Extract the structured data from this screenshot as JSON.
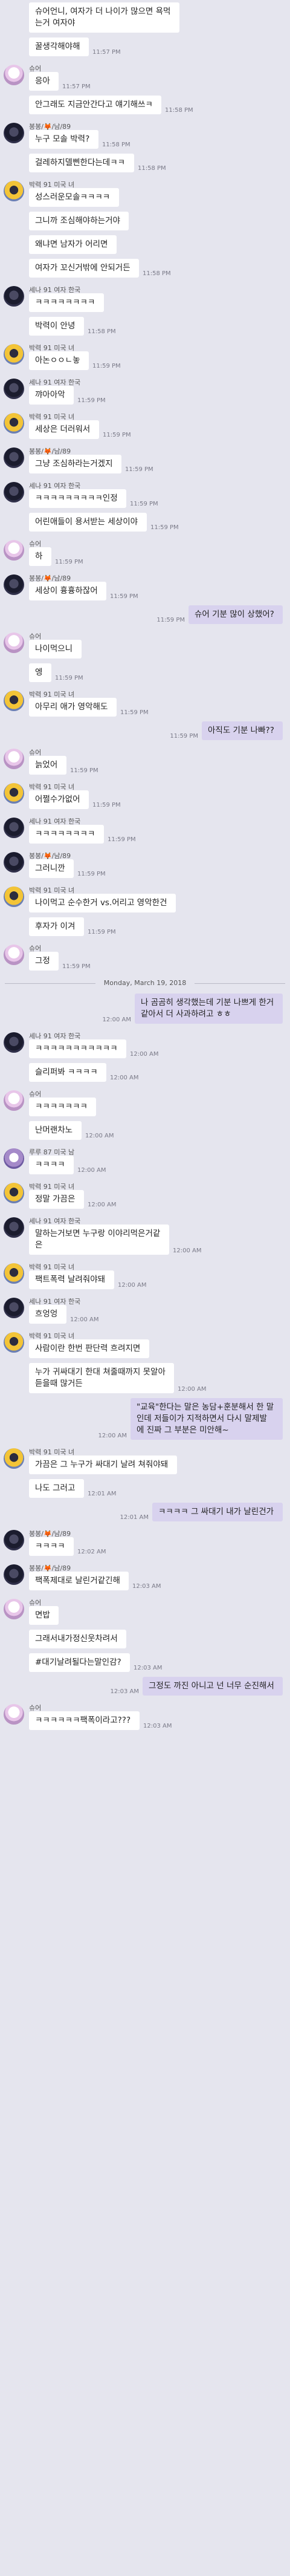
{
  "date_separator": "Monday, March 19, 2018",
  "messages": [
    {
      "side": "left",
      "sender": "",
      "avatar": "",
      "lines": [
        "슈어언니, 여자가 더 나이가 많으면 욕먹",
        "는거 여자야"
      ],
      "time": ""
    },
    {
      "side": "left",
      "sender": "",
      "avatar": "",
      "lines": [
        "꿀생각해야해"
      ],
      "time": "11:57 PM"
    },
    {
      "side": "left",
      "sender": "슈어",
      "avatar": "pink",
      "lines": [
        "응아"
      ],
      "time": "11:57 PM"
    },
    {
      "side": "left",
      "sender": "",
      "avatar": "",
      "lines": [
        "안그래도 지금안간다고 얘기해쓰ㅋ"
      ],
      "time": "11:58 PM"
    },
    {
      "side": "left",
      "sender": "봉봉/🦊/남/89",
      "avatar": "dark",
      "lines": [
        "누구 모솔 박력?"
      ],
      "time": "11:58 PM"
    },
    {
      "side": "left",
      "sender": "",
      "avatar": "",
      "lines": [
        "걸레하지델삔한다는데ㅋㅋ"
      ],
      "time": "11:58 PM"
    },
    {
      "side": "left",
      "sender": "박력 91 미국 녀",
      "avatar": "yellow",
      "lines": [
        "성스러운모솔ㅋㅋㅋㅋ"
      ],
      "time": ""
    },
    {
      "side": "left",
      "sender": "",
      "avatar": "",
      "lines": [
        "그니까 조심해야하는거야"
      ],
      "time": ""
    },
    {
      "side": "left",
      "sender": "",
      "avatar": "",
      "lines": [
        "왜냐면 남자가 어리면"
      ],
      "time": ""
    },
    {
      "side": "left",
      "sender": "",
      "avatar": "",
      "lines": [
        "여자가 꼬신거밖에 안되거든"
      ],
      "time": "11:58 PM"
    },
    {
      "side": "left",
      "sender": "세나 91 여자 한국",
      "avatar": "dark",
      "lines": [
        "ㅋㅋㅋㅋㅋㅋㅋㅋ"
      ],
      "time": ""
    },
    {
      "side": "left",
      "sender": "",
      "avatar": "",
      "lines": [
        "박력이 안녕"
      ],
      "time": "11:58 PM"
    },
    {
      "side": "left",
      "sender": "박력 91 미국 녀",
      "avatar": "yellow",
      "lines": [
        "아논ㅇㅇㄴ놓"
      ],
      "time": "11:59 PM"
    },
    {
      "side": "left",
      "sender": "세나 91 여자 한국",
      "avatar": "dark",
      "lines": [
        "꺄아아악"
      ],
      "time": "11:59 PM"
    },
    {
      "side": "left",
      "sender": "박력 91 미국 녀",
      "avatar": "yellow",
      "lines": [
        "세상은 더러워서"
      ],
      "time": "11:59 PM"
    },
    {
      "side": "left",
      "sender": "봉봉/🦊/남/89",
      "avatar": "dark",
      "lines": [
        "그냥 조심하라는거겠지"
      ],
      "time": "11:59 PM"
    },
    {
      "side": "left",
      "sender": "세나 91 여자 한국",
      "avatar": "dark",
      "lines": [
        "ㅋㅋㅋㅋㅋㅋㅋㅋㅋ인정"
      ],
      "time": "11:59 PM"
    },
    {
      "side": "left",
      "sender": "",
      "avatar": "",
      "lines": [
        "어린애들이 용서받는 세상이야"
      ],
      "time": "11:59 PM"
    },
    {
      "side": "left",
      "sender": "슈어",
      "avatar": "pink",
      "lines": [
        "하"
      ],
      "time": "11:59 PM"
    },
    {
      "side": "left",
      "sender": "봉봉/🦊/남/89",
      "avatar": "dark",
      "lines": [
        "세상이 흉흉하잖어"
      ],
      "time": "11:59 PM"
    },
    {
      "side": "right",
      "sender": "",
      "avatar": "",
      "lines": [
        "슈어 기분 많이 상했어?"
      ],
      "time": "11:59 PM"
    },
    {
      "side": "left",
      "sender": "슈어",
      "avatar": "pink",
      "lines": [
        "나이먹으니"
      ],
      "time": ""
    },
    {
      "side": "left",
      "sender": "",
      "avatar": "",
      "lines": [
        "엥"
      ],
      "time": "11:59 PM"
    },
    {
      "side": "left",
      "sender": "박력 91 미국 녀",
      "avatar": "yellow",
      "lines": [
        "아무리 애가 영악해도"
      ],
      "time": "11:59 PM"
    },
    {
      "side": "right",
      "sender": "",
      "avatar": "",
      "lines": [
        "아직도 기분 나빠??"
      ],
      "time": "11:59 PM"
    },
    {
      "side": "left",
      "sender": "슈어",
      "avatar": "pink",
      "lines": [
        "늙었어"
      ],
      "time": "11:59 PM"
    },
    {
      "side": "left",
      "sender": "박력 91 미국 녀",
      "avatar": "yellow",
      "lines": [
        "어쩔수가없어"
      ],
      "time": "11:59 PM"
    },
    {
      "side": "left",
      "sender": "세나 91 여자 한국",
      "avatar": "dark",
      "lines": [
        "ㅋㅋㅋㅋㅋㅋㅋㅋ"
      ],
      "time": "11:59 PM"
    },
    {
      "side": "left",
      "sender": "봉봉/🦊/남/89",
      "avatar": "dark",
      "lines": [
        "그러니깐"
      ],
      "time": "11:59 PM"
    },
    {
      "side": "left",
      "sender": "박력 91 미국 녀",
      "avatar": "yellow",
      "lines": [
        "나이먹고 순수한거 vs.어리고 영악한건"
      ],
      "time": ""
    },
    {
      "side": "left",
      "sender": "",
      "avatar": "",
      "lines": [
        "후자가 이겨"
      ],
      "time": "11:59 PM"
    },
    {
      "side": "left",
      "sender": "슈어",
      "avatar": "pink",
      "lines": [
        "그정"
      ],
      "time": "11:59 PM"
    },
    {
      "side": "sep"
    },
    {
      "side": "right",
      "sender": "",
      "avatar": "",
      "lines": [
        "나 곰곰히 생각했는데 기분 나쁘게 한거",
        "같아서 더 사과하려고 ㅎㅎ"
      ],
      "time": "12:00 AM"
    },
    {
      "side": "left",
      "sender": "세나 91 여자 한국",
      "avatar": "dark",
      "lines": [
        "ㅋㅋㅋㅋㅋㅋㅋㅋㅋㅋㅋ"
      ],
      "time": "12:00 AM"
    },
    {
      "side": "left",
      "sender": "",
      "avatar": "",
      "lines": [
        "슬리퍼봐 ㅋㅋㅋㅋ"
      ],
      "time": "12:00 AM"
    },
    {
      "side": "left",
      "sender": "슈어",
      "avatar": "pink",
      "lines": [
        "ㅋㅋㅋㅋㅋㅋㅋ"
      ],
      "time": ""
    },
    {
      "side": "left",
      "sender": "",
      "avatar": "",
      "lines": [
        "난머랜차노"
      ],
      "time": "12:00 AM"
    },
    {
      "side": "left",
      "sender": "루루 87 미국 남",
      "avatar": "purple",
      "lines": [
        "ㅋㅋㅋㅋ"
      ],
      "time": "12:00 AM"
    },
    {
      "side": "left",
      "sender": "박력 91 미국 녀",
      "avatar": "yellow",
      "lines": [
        "정말 가끔은"
      ],
      "time": "12:00 AM"
    },
    {
      "side": "left",
      "sender": "세나 91 여자 한국",
      "avatar": "dark",
      "lines": [
        "말하는거보면 누구랑 이야리먹은거같",
        "은"
      ],
      "time": "12:00 AM"
    },
    {
      "side": "left",
      "sender": "박력 91 미국 녀",
      "avatar": "yellow",
      "lines": [
        "팩트폭력 날려줘야돼"
      ],
      "time": "12:00 AM"
    },
    {
      "side": "left",
      "sender": "세나 91 여자 한국",
      "avatar": "dark",
      "lines": [
        "흐엉엉"
      ],
      "time": "12:00 AM"
    },
    {
      "side": "left",
      "sender": "박력 91 미국 녀",
      "avatar": "yellow",
      "lines": [
        "사람이란 한번 판단력 흐려지면"
      ],
      "time": ""
    },
    {
      "side": "left",
      "sender": "",
      "avatar": "",
      "lines": [
        "누가 귀싸대기 한대 쳐줄때까지 못알아",
        "듣을때 많거든"
      ],
      "time": "12:00 AM"
    },
    {
      "side": "right",
      "sender": "",
      "avatar": "",
      "lines": [
        "\"교육\"한다는 말은 농담+훈분해서 한 말",
        "인데 저들이가 지적하면서 다시 말제발",
        "에 진짜 그 부분은 미안해~"
      ],
      "time": "12:00 AM"
    },
    {
      "side": "left",
      "sender": "박력 91 미국 녀",
      "avatar": "yellow",
      "lines": [
        "가끔은 그 누구가 싸대기 날려 쳐줘야돼"
      ],
      "time": ""
    },
    {
      "side": "left",
      "sender": "",
      "avatar": "",
      "lines": [
        "나도 그러고"
      ],
      "time": "12:01 AM"
    },
    {
      "side": "right",
      "sender": "",
      "avatar": "",
      "lines": [
        "ㅋㅋㅋㅋ 그 싸대기 내가 날린건가"
      ],
      "time": "12:01 AM"
    },
    {
      "side": "left",
      "sender": "봉봉/🦊/남/89",
      "avatar": "dark",
      "lines": [
        "ㅋㅋㅋㅋ"
      ],
      "time": "12:02 AM"
    },
    {
      "side": "left",
      "sender": "봉봉/🦊/남/89",
      "avatar": "dark",
      "lines": [
        "팩폭제대로 날린거같긴해"
      ],
      "time": "12:03 AM"
    },
    {
      "side": "left",
      "sender": "슈어",
      "avatar": "pink",
      "lines": [
        "면밥"
      ],
      "time": ""
    },
    {
      "side": "left",
      "sender": "",
      "avatar": "",
      "lines": [
        "그래서내가정신웃차려서"
      ],
      "time": ""
    },
    {
      "side": "left",
      "sender": "",
      "avatar": "",
      "lines": [
        "#대기날려될다는말인감?"
      ],
      "time": "12:03 AM"
    },
    {
      "side": "right",
      "sender": "",
      "avatar": "",
      "lines": [
        "그정도 까진 아니고 넌 너무 순진해서"
      ],
      "time": "12:03 AM"
    },
    {
      "side": "left",
      "sender": "슈어",
      "avatar": "pink",
      "lines": [
        "ㅋㅋㅋㅋㅋㅋ팩폭이라고???"
      ],
      "time": "12:03 AM"
    }
  ]
}
